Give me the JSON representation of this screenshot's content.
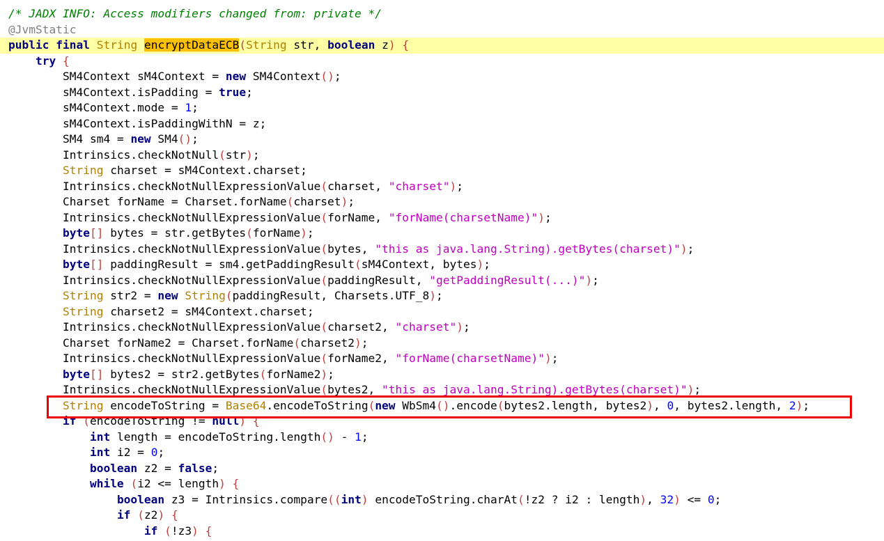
{
  "editor": {
    "highlighted_token": "encryptDataECB",
    "lines": [
      {
        "indent": 0,
        "tokens": [
          {
            "t": "cmt",
            "v": "/* JADX INFO: Access modifiers changed from: private */"
          }
        ]
      },
      {
        "indent": 0,
        "tokens": [
          {
            "t": "ann",
            "v": "@JvmStatic"
          }
        ]
      },
      {
        "indent": 0,
        "current": true,
        "tokens": [
          {
            "t": "kw",
            "v": "public"
          },
          {
            "t": "plain",
            "v": " "
          },
          {
            "t": "kw",
            "v": "final"
          },
          {
            "t": "plain",
            "v": " "
          },
          {
            "t": "type",
            "v": "String"
          },
          {
            "t": "plain",
            "v": " "
          },
          {
            "t": "hl",
            "v": "encryptDataECB"
          },
          {
            "t": "punct",
            "v": "("
          },
          {
            "t": "type",
            "v": "String"
          },
          {
            "t": "plain",
            "v": " str, "
          },
          {
            "t": "kw",
            "v": "boolean"
          },
          {
            "t": "plain",
            "v": " z"
          },
          {
            "t": "punct",
            "v": ")"
          },
          {
            "t": "plain",
            "v": " "
          },
          {
            "t": "punct",
            "v": "{"
          }
        ]
      },
      {
        "indent": 1,
        "tokens": [
          {
            "t": "kw",
            "v": "try"
          },
          {
            "t": "plain",
            "v": " "
          },
          {
            "t": "punct",
            "v": "{"
          }
        ]
      },
      {
        "indent": 2,
        "tokens": [
          {
            "t": "plain",
            "v": "SM4Context sM4Context = "
          },
          {
            "t": "kw",
            "v": "new"
          },
          {
            "t": "plain",
            "v": " SM4Context"
          },
          {
            "t": "punct",
            "v": "()"
          },
          {
            "t": "plain",
            "v": ";"
          }
        ]
      },
      {
        "indent": 2,
        "tokens": [
          {
            "t": "plain",
            "v": "sM4Context.isPadding = "
          },
          {
            "t": "kw",
            "v": "true"
          },
          {
            "t": "plain",
            "v": ";"
          }
        ]
      },
      {
        "indent": 2,
        "tokens": [
          {
            "t": "plain",
            "v": "sM4Context.mode = "
          },
          {
            "t": "num",
            "v": "1"
          },
          {
            "t": "plain",
            "v": ";"
          }
        ]
      },
      {
        "indent": 2,
        "tokens": [
          {
            "t": "plain",
            "v": "sM4Context.isPaddingWithN = z;"
          }
        ]
      },
      {
        "indent": 2,
        "tokens": [
          {
            "t": "plain",
            "v": "SM4 sm4 = "
          },
          {
            "t": "kw",
            "v": "new"
          },
          {
            "t": "plain",
            "v": " SM4"
          },
          {
            "t": "punct",
            "v": "()"
          },
          {
            "t": "plain",
            "v": ";"
          }
        ]
      },
      {
        "indent": 2,
        "tokens": [
          {
            "t": "plain",
            "v": "Intrinsics.checkNotNull"
          },
          {
            "t": "punct",
            "v": "("
          },
          {
            "t": "plain",
            "v": "str"
          },
          {
            "t": "punct",
            "v": ")"
          },
          {
            "t": "plain",
            "v": ";"
          }
        ]
      },
      {
        "indent": 2,
        "tokens": [
          {
            "t": "type",
            "v": "String"
          },
          {
            "t": "plain",
            "v": " charset = sM4Context.charset;"
          }
        ]
      },
      {
        "indent": 2,
        "tokens": [
          {
            "t": "plain",
            "v": "Intrinsics.checkNotNullExpressionValue"
          },
          {
            "t": "punct",
            "v": "("
          },
          {
            "t": "plain",
            "v": "charset, "
          },
          {
            "t": "str",
            "v": "\"charset\""
          },
          {
            "t": "punct",
            "v": ")"
          },
          {
            "t": "plain",
            "v": ";"
          }
        ]
      },
      {
        "indent": 2,
        "tokens": [
          {
            "t": "plain",
            "v": "Charset forName = Charset.forName"
          },
          {
            "t": "punct",
            "v": "("
          },
          {
            "t": "plain",
            "v": "charset"
          },
          {
            "t": "punct",
            "v": ")"
          },
          {
            "t": "plain",
            "v": ";"
          }
        ]
      },
      {
        "indent": 2,
        "tokens": [
          {
            "t": "plain",
            "v": "Intrinsics.checkNotNullExpressionValue"
          },
          {
            "t": "punct",
            "v": "("
          },
          {
            "t": "plain",
            "v": "forName, "
          },
          {
            "t": "str",
            "v": "\"forName(charsetName)\""
          },
          {
            "t": "punct",
            "v": ")"
          },
          {
            "t": "plain",
            "v": ";"
          }
        ]
      },
      {
        "indent": 2,
        "tokens": [
          {
            "t": "kw",
            "v": "byte"
          },
          {
            "t": "punct",
            "v": "[]"
          },
          {
            "t": "plain",
            "v": " bytes = str.getBytes"
          },
          {
            "t": "punct",
            "v": "("
          },
          {
            "t": "plain",
            "v": "forName"
          },
          {
            "t": "punct",
            "v": ")"
          },
          {
            "t": "plain",
            "v": ";"
          }
        ]
      },
      {
        "indent": 2,
        "tokens": [
          {
            "t": "plain",
            "v": "Intrinsics.checkNotNullExpressionValue"
          },
          {
            "t": "punct",
            "v": "("
          },
          {
            "t": "plain",
            "v": "bytes, "
          },
          {
            "t": "str",
            "v": "\"this as java.lang.String).getBytes(charset)\""
          },
          {
            "t": "punct",
            "v": ")"
          },
          {
            "t": "plain",
            "v": ";"
          }
        ]
      },
      {
        "indent": 2,
        "tokens": [
          {
            "t": "kw",
            "v": "byte"
          },
          {
            "t": "punct",
            "v": "[]"
          },
          {
            "t": "plain",
            "v": " paddingResult = sm4.getPaddingResult"
          },
          {
            "t": "punct",
            "v": "("
          },
          {
            "t": "plain",
            "v": "sM4Context, bytes"
          },
          {
            "t": "punct",
            "v": ")"
          },
          {
            "t": "plain",
            "v": ";"
          }
        ]
      },
      {
        "indent": 2,
        "tokens": [
          {
            "t": "plain",
            "v": "Intrinsics.checkNotNullExpressionValue"
          },
          {
            "t": "punct",
            "v": "("
          },
          {
            "t": "plain",
            "v": "paddingResult, "
          },
          {
            "t": "str",
            "v": "\"getPaddingResult(...)\""
          },
          {
            "t": "punct",
            "v": ")"
          },
          {
            "t": "plain",
            "v": ";"
          }
        ]
      },
      {
        "indent": 2,
        "tokens": [
          {
            "t": "type",
            "v": "String"
          },
          {
            "t": "plain",
            "v": " str2 = "
          },
          {
            "t": "kw",
            "v": "new"
          },
          {
            "t": "plain",
            "v": " "
          },
          {
            "t": "type",
            "v": "String"
          },
          {
            "t": "punct",
            "v": "("
          },
          {
            "t": "plain",
            "v": "paddingResult, Charsets.UTF_8"
          },
          {
            "t": "punct",
            "v": ")"
          },
          {
            "t": "plain",
            "v": ";"
          }
        ]
      },
      {
        "indent": 2,
        "tokens": [
          {
            "t": "type",
            "v": "String"
          },
          {
            "t": "plain",
            "v": " charset2 = sM4Context.charset;"
          }
        ]
      },
      {
        "indent": 2,
        "tokens": [
          {
            "t": "plain",
            "v": "Intrinsics.checkNotNullExpressionValue"
          },
          {
            "t": "punct",
            "v": "("
          },
          {
            "t": "plain",
            "v": "charset2, "
          },
          {
            "t": "str",
            "v": "\"charset\""
          },
          {
            "t": "punct",
            "v": ")"
          },
          {
            "t": "plain",
            "v": ";"
          }
        ]
      },
      {
        "indent": 2,
        "tokens": [
          {
            "t": "plain",
            "v": "Charset forName2 = Charset.forName"
          },
          {
            "t": "punct",
            "v": "("
          },
          {
            "t": "plain",
            "v": "charset2"
          },
          {
            "t": "punct",
            "v": ")"
          },
          {
            "t": "plain",
            "v": ";"
          }
        ]
      },
      {
        "indent": 2,
        "tokens": [
          {
            "t": "plain",
            "v": "Intrinsics.checkNotNullExpressionValue"
          },
          {
            "t": "punct",
            "v": "("
          },
          {
            "t": "plain",
            "v": "forName2, "
          },
          {
            "t": "str",
            "v": "\"forName(charsetName)\""
          },
          {
            "t": "punct",
            "v": ")"
          },
          {
            "t": "plain",
            "v": ";"
          }
        ]
      },
      {
        "indent": 2,
        "tokens": [
          {
            "t": "kw",
            "v": "byte"
          },
          {
            "t": "punct",
            "v": "[]"
          },
          {
            "t": "plain",
            "v": " bytes2 = str2.getBytes"
          },
          {
            "t": "punct",
            "v": "("
          },
          {
            "t": "plain",
            "v": "forName2"
          },
          {
            "t": "punct",
            "v": ")"
          },
          {
            "t": "plain",
            "v": ";"
          }
        ]
      },
      {
        "indent": 2,
        "tokens": [
          {
            "t": "plain",
            "v": "Intrinsics.checkNotNullExpressionValue"
          },
          {
            "t": "punct",
            "v": "("
          },
          {
            "t": "plain",
            "v": "bytes2, "
          },
          {
            "t": "str",
            "v": "\"this as java.lang.String).getBytes(charset)\""
          },
          {
            "t": "punct",
            "v": ")"
          },
          {
            "t": "plain",
            "v": ";"
          }
        ]
      },
      {
        "indent": 2,
        "boxed": true,
        "tokens": [
          {
            "t": "type",
            "v": "String"
          },
          {
            "t": "plain",
            "v": " encodeToString = "
          },
          {
            "t": "type",
            "v": "Base64"
          },
          {
            "t": "plain",
            "v": ".encodeToString"
          },
          {
            "t": "punct",
            "v": "("
          },
          {
            "t": "kw",
            "v": "new"
          },
          {
            "t": "plain",
            "v": " WbSm4"
          },
          {
            "t": "punct",
            "v": "()"
          },
          {
            "t": "plain",
            "v": ".encode"
          },
          {
            "t": "punct",
            "v": "("
          },
          {
            "t": "plain",
            "v": "bytes2.length, bytes2"
          },
          {
            "t": "punct",
            "v": ")"
          },
          {
            "t": "plain",
            "v": ", "
          },
          {
            "t": "num",
            "v": "0"
          },
          {
            "t": "plain",
            "v": ", bytes2.length, "
          },
          {
            "t": "num",
            "v": "2"
          },
          {
            "t": "punct",
            "v": ")"
          },
          {
            "t": "plain",
            "v": ";"
          }
        ]
      },
      {
        "indent": 2,
        "tokens": [
          {
            "t": "kw",
            "v": "if"
          },
          {
            "t": "plain",
            "v": " "
          },
          {
            "t": "punct",
            "v": "("
          },
          {
            "t": "plain",
            "v": "encodeToString != "
          },
          {
            "t": "kw",
            "v": "null"
          },
          {
            "t": "punct",
            "v": ")"
          },
          {
            "t": "plain",
            "v": " "
          },
          {
            "t": "punct",
            "v": "{"
          }
        ]
      },
      {
        "indent": 3,
        "tokens": [
          {
            "t": "kw",
            "v": "int"
          },
          {
            "t": "plain",
            "v": " length = encodeToString.length"
          },
          {
            "t": "punct",
            "v": "()"
          },
          {
            "t": "plain",
            "v": " - "
          },
          {
            "t": "num",
            "v": "1"
          },
          {
            "t": "plain",
            "v": ";"
          }
        ]
      },
      {
        "indent": 3,
        "tokens": [
          {
            "t": "kw",
            "v": "int"
          },
          {
            "t": "plain",
            "v": " i2 = "
          },
          {
            "t": "num",
            "v": "0"
          },
          {
            "t": "plain",
            "v": ";"
          }
        ]
      },
      {
        "indent": 3,
        "tokens": [
          {
            "t": "kw",
            "v": "boolean"
          },
          {
            "t": "plain",
            "v": " z2 = "
          },
          {
            "t": "kw",
            "v": "false"
          },
          {
            "t": "plain",
            "v": ";"
          }
        ]
      },
      {
        "indent": 3,
        "tokens": [
          {
            "t": "kw",
            "v": "while"
          },
          {
            "t": "plain",
            "v": " "
          },
          {
            "t": "punct",
            "v": "("
          },
          {
            "t": "plain",
            "v": "i2 <= length"
          },
          {
            "t": "punct",
            "v": ")"
          },
          {
            "t": "plain",
            "v": " "
          },
          {
            "t": "punct",
            "v": "{"
          }
        ]
      },
      {
        "indent": 4,
        "tokens": [
          {
            "t": "kw",
            "v": "boolean"
          },
          {
            "t": "plain",
            "v": " z3 = Intrinsics.compare"
          },
          {
            "t": "punct",
            "v": "(("
          },
          {
            "t": "kw",
            "v": "int"
          },
          {
            "t": "punct",
            "v": ")"
          },
          {
            "t": "plain",
            "v": " encodeToString.charAt"
          },
          {
            "t": "punct",
            "v": "("
          },
          {
            "t": "plain",
            "v": "!z2 ? i2 : length"
          },
          {
            "t": "punct",
            "v": ")"
          },
          {
            "t": "plain",
            "v": ", "
          },
          {
            "t": "num",
            "v": "32"
          },
          {
            "t": "punct",
            "v": ")"
          },
          {
            "t": "plain",
            "v": " <= "
          },
          {
            "t": "num",
            "v": "0"
          },
          {
            "t": "plain",
            "v": ";"
          }
        ]
      },
      {
        "indent": 4,
        "tokens": [
          {
            "t": "kw",
            "v": "if"
          },
          {
            "t": "plain",
            "v": " "
          },
          {
            "t": "punct",
            "v": "("
          },
          {
            "t": "plain",
            "v": "z2"
          },
          {
            "t": "punct",
            "v": ")"
          },
          {
            "t": "plain",
            "v": " "
          },
          {
            "t": "punct",
            "v": "{"
          }
        ]
      },
      {
        "indent": 5,
        "tokens": [
          {
            "t": "kw",
            "v": "if"
          },
          {
            "t": "plain",
            "v": " "
          },
          {
            "t": "punct",
            "v": "("
          },
          {
            "t": "plain",
            "v": "!z3"
          },
          {
            "t": "punct",
            "v": ")"
          },
          {
            "t": "plain",
            "v": " "
          },
          {
            "t": "punct",
            "v": "{"
          }
        ]
      }
    ]
  },
  "colors": {
    "keyword": "#000080",
    "type": "#b08000",
    "string": "#c000c0",
    "number": "#0000ff",
    "comment": "#008000",
    "annotation": "#808080",
    "punctuation": "#c04040",
    "current_line_bg": "#ffffa4",
    "token_highlight_bg": "#ffc000",
    "annotation_box": "#ee0000"
  }
}
